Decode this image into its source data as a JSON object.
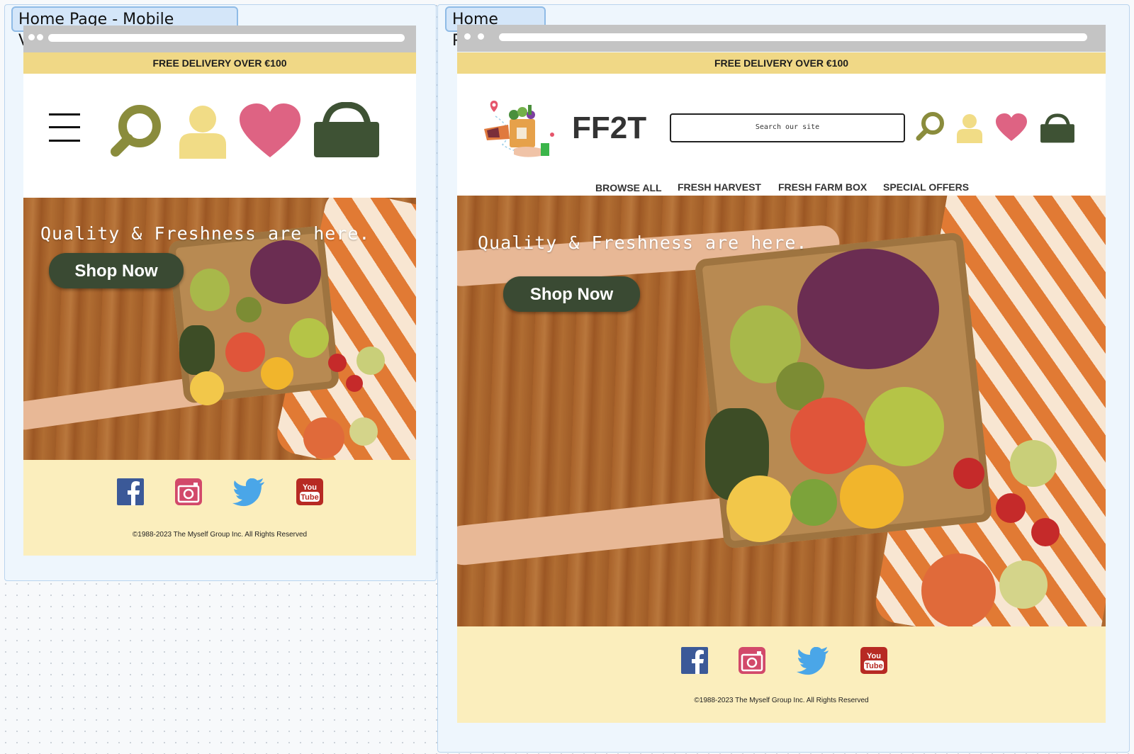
{
  "colors": {
    "promo": "#f0d886",
    "button": "#3a4a33",
    "footer": "#fbeebd",
    "search_icon": "#8a8c3c",
    "user_icon": "#f1dc86",
    "heart_icon": "#de6383",
    "bag_icon": "#3e5234"
  },
  "mobile": {
    "frame_label": "Home Page - Mobile Version",
    "promo": "FREE DELIVERY OVER €100",
    "hero_title": "Quality & Freshness are here.",
    "cta": "Shop Now",
    "copyright": "©1988-2023 The Myself Group Inc. All Rights Reserved"
  },
  "desktop": {
    "frame_label": "Home Page",
    "promo": "FREE DELIVERY OVER €100",
    "brand": "FF2T",
    "search_placeholder": "Search our site",
    "nav": [
      "BROWSE ALL",
      "FRESH HARVEST",
      "FRESH FARM BOX",
      "SPECIAL OFFERS"
    ],
    "hero_title": "Quality & Freshness are here.",
    "cta": "Shop Now",
    "copyright": "©1988-2023 The Myself Group Inc. All Rights Reserved"
  },
  "icons": [
    "menu-icon",
    "search-icon",
    "user-icon",
    "heart-icon",
    "bag-icon",
    "facebook-icon",
    "instagram-icon",
    "twitter-icon",
    "youtube-icon"
  ]
}
